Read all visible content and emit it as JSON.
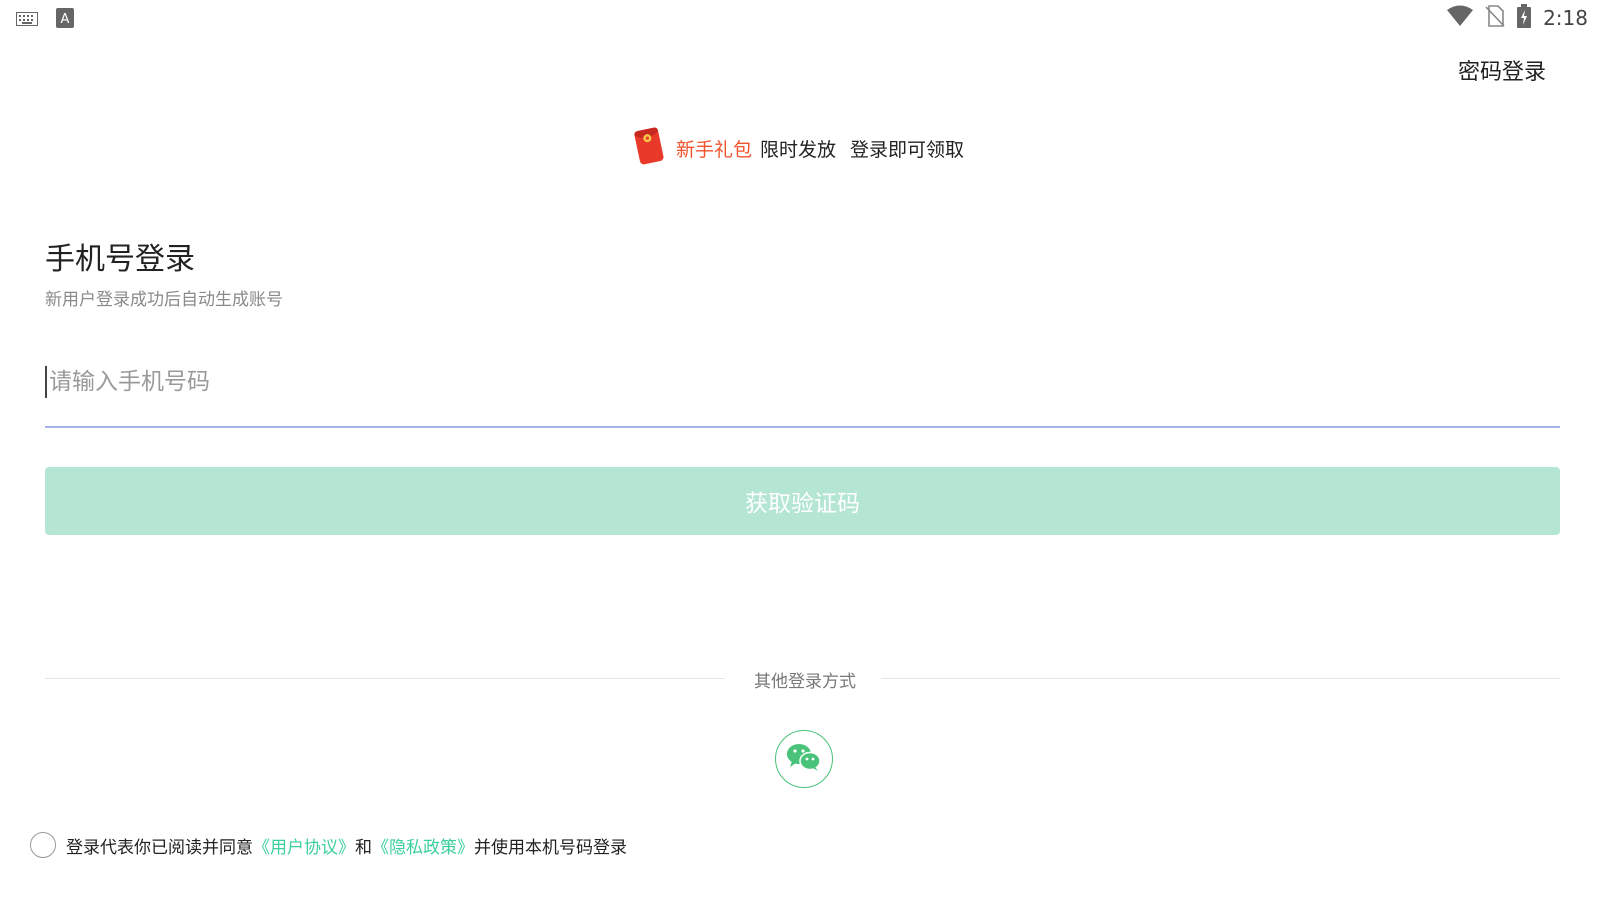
{
  "status_bar": {
    "left_icons": [
      "keyboard-icon",
      "input-method-icon"
    ],
    "right_icons": [
      "wifi-icon",
      "no-sim-icon",
      "battery-charging-icon"
    ],
    "input_method_letter": "A",
    "time": "2:18"
  },
  "header": {
    "password_login_label": "密码登录"
  },
  "promo": {
    "icon": "red-envelope-icon",
    "highlight": "新手礼包",
    "text1": "限时发放",
    "text2": "登录即可领取",
    "highlight_color": "#f0532d"
  },
  "login": {
    "title": "手机号登录",
    "subtitle": "新用户登录成功后自动生成账号",
    "phone_placeholder": "请输入手机号码",
    "phone_value": "",
    "get_code_label": "获取验证码",
    "button_color": "#b5e6d3"
  },
  "other_login": {
    "label": "其他登录方式",
    "methods": [
      "wechat-icon"
    ]
  },
  "agreement": {
    "checked": false,
    "prefix": "登录代表你已阅读并同意",
    "user_agreement": "《用户协议》",
    "and": "和",
    "privacy_policy": "《隐私政策》",
    "suffix": "并使用本机号码登录",
    "link_color": "#3ccf9e"
  }
}
